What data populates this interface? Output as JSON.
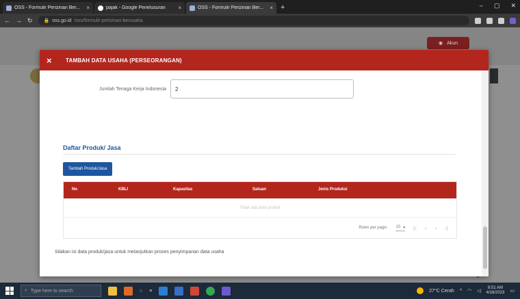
{
  "browser": {
    "tabs": [
      {
        "title": "OSS - Formulir Perizinan Ber...",
        "active": false
      },
      {
        "title": "pajak - Google Penelusuran",
        "active": false
      },
      {
        "title": "OSS - Formulir Perizinan Ber...",
        "active": true
      }
    ],
    "new_tab": "+",
    "url_host": "oss.go.id",
    "url_rest": "/oss/formulir-perizinan-berusaha"
  },
  "background_page": {
    "header_button": "Akun"
  },
  "modal": {
    "title": "TAMBAH DATA USAHA (PERSEORANGAN)",
    "close": "×",
    "tenaga_kerja_label": "Jumlah Tenaga Kerja Indonesia",
    "tenaga_kerja_value": "2",
    "section_title": "Daftar Produk/ Jasa",
    "add_button": "Tambah Produk/Jasa",
    "table": {
      "columns": [
        "No",
        "KBLI",
        "Kapasitas",
        "Satuan",
        "Jenis Produksi"
      ],
      "empty_text": "Tidak ada data produk",
      "rows_per_page_label": "Rows per page:",
      "rows_per_page_value": "10"
    },
    "note": "Silakan isi data produk/jasa untuk melanjutkan proses penyimpanan data usaha"
  },
  "taskbar": {
    "search_placeholder": "Type here to search",
    "weather": "27°C Cerah",
    "time": "8:51 AM",
    "date": "4/16/2023"
  },
  "colors": {
    "modal_header": "#b3261e",
    "accent_blue": "#1e56a0"
  }
}
